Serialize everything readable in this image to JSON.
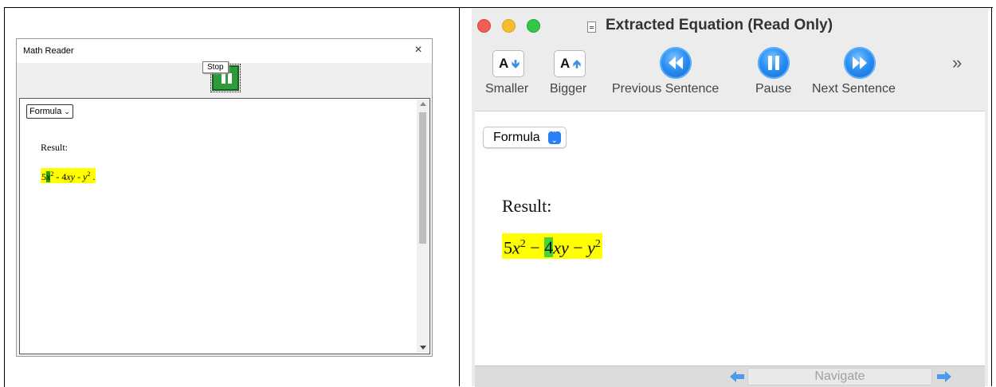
{
  "windows_app": {
    "title": "Math Reader",
    "close_glyph": "×",
    "toolbar_button_icon": "pause-icon",
    "tooltip": "Stop",
    "select_value": "Formula",
    "result_label": "Result:",
    "formula": {
      "p1": "5",
      "p2": "x",
      "p3": "2",
      "p4": " - 4",
      "p5": "xy",
      "p6": " - ",
      "p7": "y",
      "p8": "2",
      "p9": " ."
    },
    "colors": {
      "highlight": "#ffff00",
      "word_highlight": "#1ea800",
      "pause_button": "#2e9a3a"
    }
  },
  "mac_app": {
    "title": "Extracted Equation (Read Only)",
    "toolbar": {
      "smaller_label": "Smaller",
      "bigger_label": "Bigger",
      "prev_label": "Previous Sentence",
      "pause_label": "Pause",
      "next_label": "Next Sentence",
      "font_glyph": "A",
      "more_glyph": "»"
    },
    "select_value": "Formula",
    "result_label": "Result:",
    "formula": {
      "p1": "5",
      "p2": "x",
      "p3": "2",
      "p4": " − ",
      "p5": "4",
      "p6": "xy",
      "p7": " − ",
      "p8": "y",
      "p9": "2"
    },
    "navigate_label": "Navigate",
    "colors": {
      "highlight": "#ffff00",
      "word_highlight": "#48d23a",
      "accent": "#2a8ef2"
    }
  }
}
